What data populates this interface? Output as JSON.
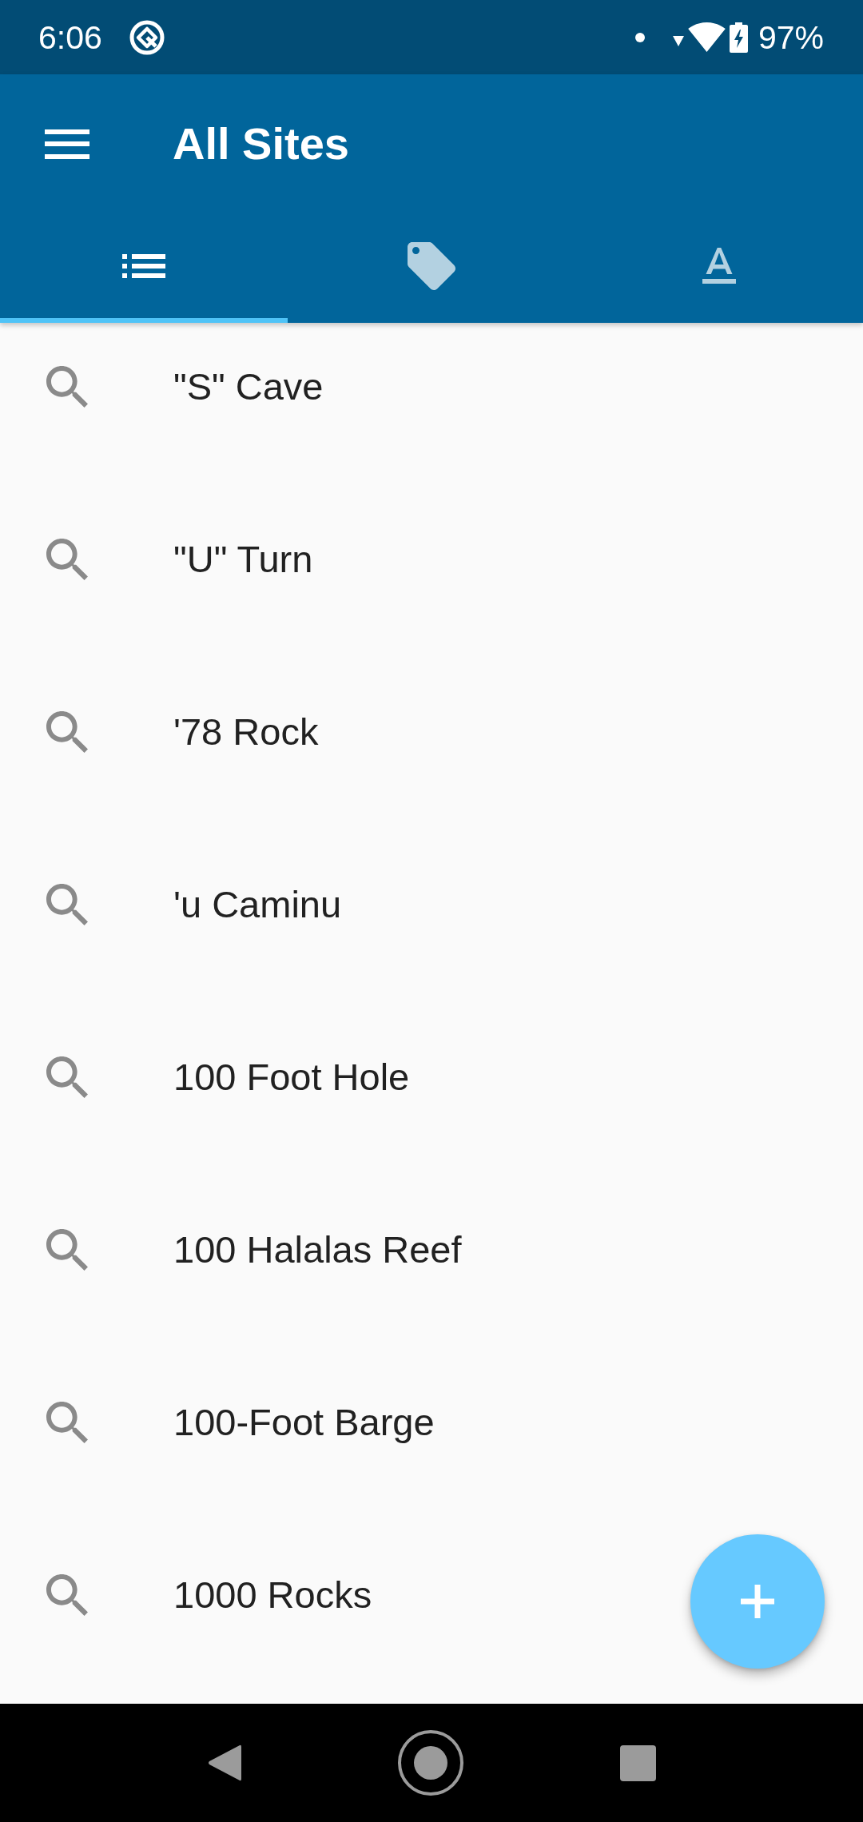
{
  "status_bar": {
    "time": "6:06",
    "battery": "97%"
  },
  "app_bar": {
    "title": "All Sites"
  },
  "tabs": [
    {
      "kind": "list",
      "selected": true
    },
    {
      "kind": "tags",
      "selected": false
    },
    {
      "kind": "alphabet",
      "selected": false
    }
  ],
  "sites": [
    "\"S\" Cave",
    "\"U\" Turn",
    "'78 Rock",
    "'u Caminu",
    "100 Foot Hole",
    "100 Halalas Reef",
    "100-Foot Barge",
    "1000 Rocks"
  ]
}
